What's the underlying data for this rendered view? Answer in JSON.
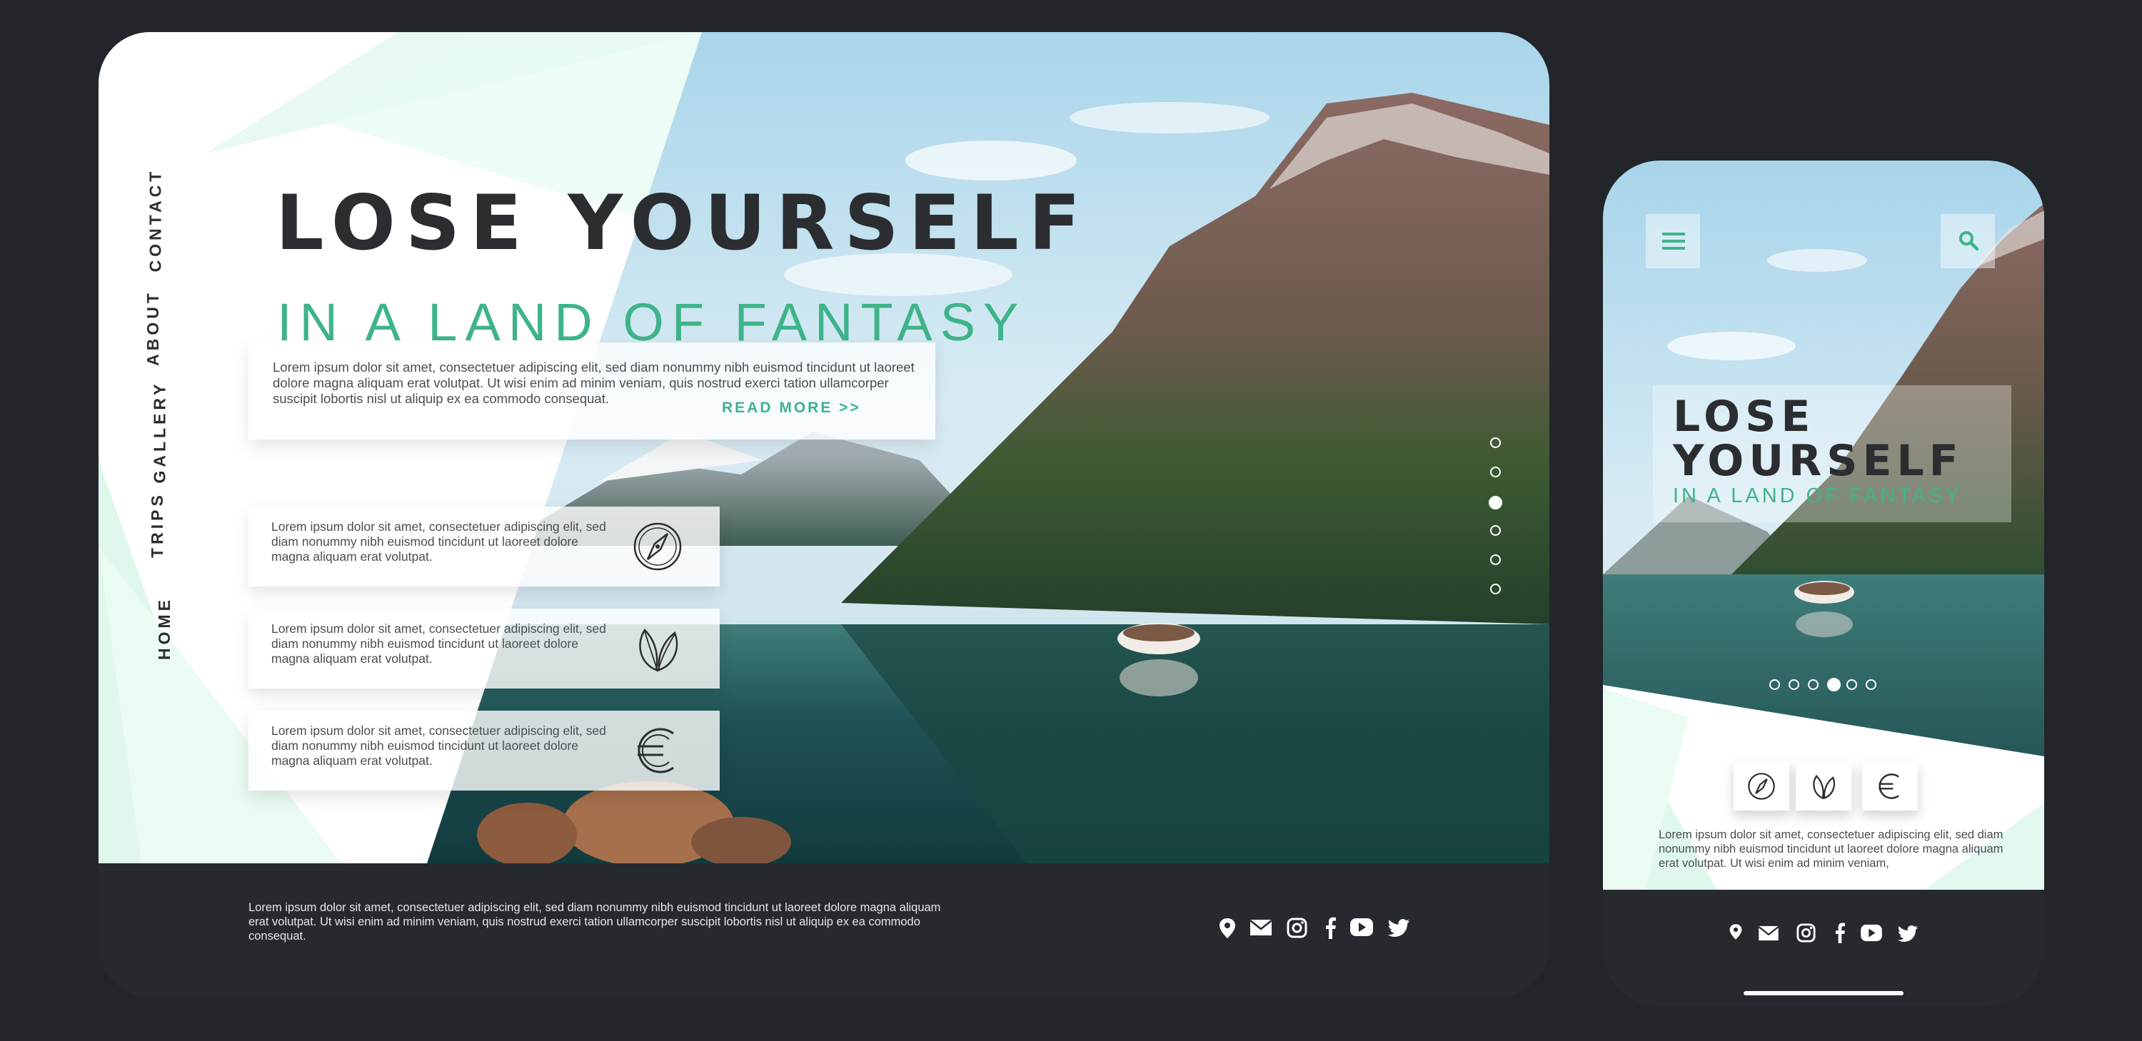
{
  "desktop": {
    "nav": [
      "HOME",
      "TRIPS",
      "GALLERY",
      "ABOUT",
      "CONTACT"
    ],
    "title": "LOSE YOURSELF",
    "subtitle": "IN A LAND OF FANTASY",
    "intro_text": "Lorem ipsum dolor sit amet, consectetuer adipiscing elit, sed diam nonummy nibh euismod tincidunt ut laoreet dolore magna aliquam erat volutpat. Ut wisi enim ad minim veniam, quis nostrud exerci tation ullamcorper suscipit lobortis nisl ut aliquip ex ea commodo consequat.",
    "read_more": "READ MORE >>",
    "cards": [
      {
        "text": "Lorem ipsum dolor sit amet, consectetuer adipiscing elit, sed diam nonummy nibh euismod tincidunt ut laoreet dolore magna aliquam erat volutpat.",
        "icon": "compass-icon"
      },
      {
        "text": "Lorem ipsum dolor sit amet, consectetuer adipiscing elit, sed diam nonummy nibh euismod tincidunt ut laoreet dolore magna aliquam erat volutpat.",
        "icon": "leaf-icon"
      },
      {
        "text": "Lorem ipsum dolor sit amet, consectetuer adipiscing elit, sed diam nonummy nibh euismod tincidunt ut laoreet dolore magna aliquam erat volutpat.",
        "icon": "euro-icon"
      }
    ],
    "slider": {
      "count": 6,
      "active_index": 2
    },
    "footer_text": "Lorem ipsum dolor sit amet, consectetuer adipiscing elit, sed diam nonummy nibh euismod tincidunt ut laoreet dolore magna aliquam erat volutpat. Ut wisi enim ad minim veniam, quis nostrud exerci tation ullamcorper suscipit lobortis nisl ut aliquip ex ea commodo consequat.",
    "social_icons": [
      "location-pin-icon",
      "mail-icon",
      "instagram-icon",
      "facebook-icon",
      "youtube-icon",
      "twitter-icon"
    ]
  },
  "mobile": {
    "menu_icon": "hamburger-menu-icon",
    "search_icon": "search-icon",
    "title": "LOSE YOURSELF",
    "subtitle": "IN A LAND OF FANTASY",
    "slider": {
      "count": 6,
      "active_index": 3
    },
    "feature_icons": [
      "compass-icon",
      "leaf-icon",
      "euro-icon"
    ],
    "body_text": "Lorem ipsum dolor sit amet, consectetuer adipiscing elit, sed diam nonummy nibh euismod tincidunt ut laoreet dolore magna aliquam erat volutpat. Ut wisi enim ad minim veniam,",
    "social_icons": [
      "location-pin-icon",
      "mail-icon",
      "instagram-icon",
      "facebook-icon",
      "youtube-icon",
      "twitter-icon"
    ]
  },
  "colors": {
    "background": "#22262a",
    "footer": "#262a2e",
    "accent_green": "#3fb389",
    "mint": "#dff8ec",
    "title_dark": "#2b2d30"
  }
}
